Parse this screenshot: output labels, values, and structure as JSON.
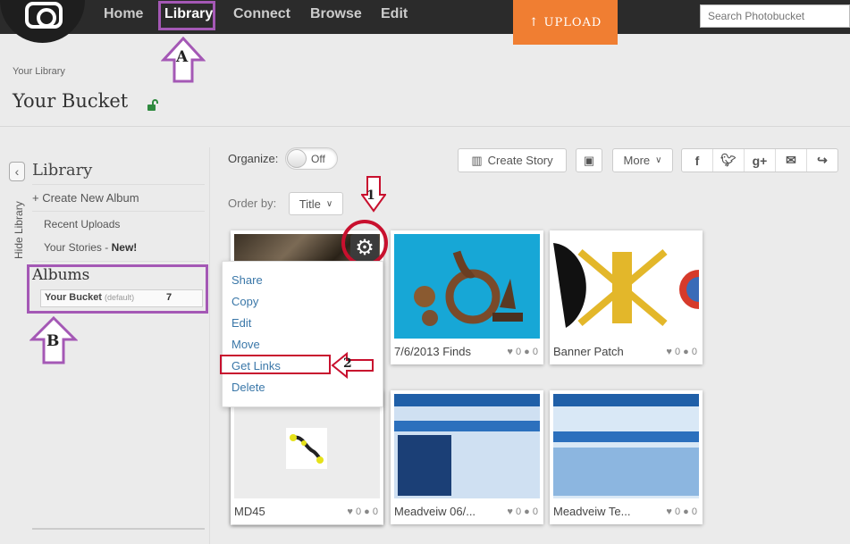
{
  "nav": {
    "items": [
      "Home",
      "Library",
      "Connect",
      "Browse",
      "Edit"
    ],
    "upload_label": "UPLOAD",
    "search_placeholder": "Search Photobucket"
  },
  "breadcrumb": "Your Library",
  "page_title": "Your Bucket",
  "sidebar": {
    "hide_label": "Hide Library",
    "heading": "Library",
    "create_album": "+ Create New Album",
    "recent_uploads": "Recent Uploads",
    "your_stories": "Your Stories",
    "stories_badge": "New!",
    "albums_heading": "Albums",
    "album_name": "Your Bucket",
    "album_default": "(default)",
    "album_count": "7"
  },
  "toolbar": {
    "organize_label": "Organize:",
    "toggle_value": "Off",
    "order_label": "Order by:",
    "order_value": "Title",
    "create_story": "Create Story",
    "more": "More"
  },
  "context_menu": [
    "Share",
    "Copy",
    "Edit",
    "Move",
    "Get Links",
    "Delete"
  ],
  "cards": [
    {
      "caption": "7/6/2013 Finds",
      "likes": "0",
      "comments": "0"
    },
    {
      "caption": "Banner Patch",
      "likes": "0",
      "comments": "0"
    },
    {
      "caption": "MD45",
      "likes": "0",
      "comments": "0"
    },
    {
      "caption": "Meadveiw 06/...",
      "likes": "0",
      "comments": "0"
    },
    {
      "caption": "Meadveiw Te...",
      "likes": "0",
      "comments": "0"
    }
  ],
  "annotations": {
    "a": "A",
    "b": "B",
    "one": "1",
    "two": "2"
  },
  "colors": {
    "accent": "#f07e32",
    "annotation_purple": "#a458b5",
    "annotation_red": "#c8102e"
  }
}
